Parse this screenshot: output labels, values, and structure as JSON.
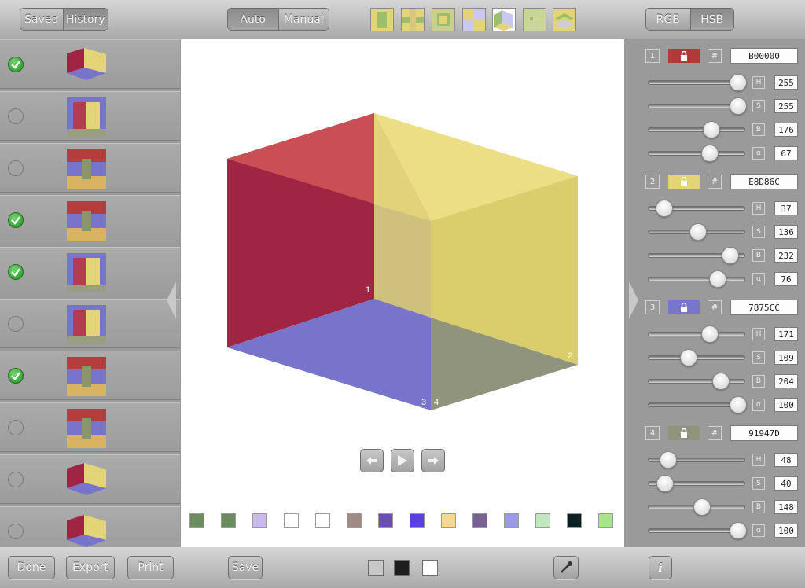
{
  "left_panel": {
    "tabs": [
      {
        "label": "Saved"
      },
      {
        "label": "History"
      }
    ],
    "items": [
      {
        "checked": true,
        "thumb": "cube-thumb"
      },
      {
        "checked": false,
        "thumb": "squares-thumb"
      },
      {
        "checked": false,
        "thumb": "stripes-thumb"
      },
      {
        "checked": true,
        "thumb": "stripes-thumb"
      },
      {
        "checked": true,
        "thumb": "squares-thumb"
      },
      {
        "checked": false,
        "thumb": "squares-thumb"
      },
      {
        "checked": true,
        "thumb": "stripes-thumb"
      },
      {
        "checked": false,
        "thumb": "stripes-thumb"
      },
      {
        "checked": false,
        "thumb": "cube-thumb"
      },
      {
        "checked": false,
        "thumb": "cube-thumb"
      }
    ],
    "buttons": {
      "done": "Done",
      "export": "Export",
      "print": "Print"
    }
  },
  "center": {
    "mode_tabs": [
      {
        "label": "Auto"
      },
      {
        "label": "Manual"
      }
    ],
    "layout_tools": [
      "stripes-layout-icon",
      "cross-layout-icon",
      "frame-layout-icon",
      "grid-layout-icon",
      "cube-layout-icon",
      "dots-layout-icon",
      "layers-layout-icon"
    ],
    "cube_labels": {
      "c1": "1",
      "c2": "2",
      "c3": "3",
      "c4": "4"
    },
    "swatches": [
      "#6f8c5e",
      "#6a8a60",
      "#c9b8ee",
      "#ffffff",
      "#ffffff",
      "#a08a84",
      "#6a4fae",
      "#5a3fe0",
      "#f7d796",
      "#786294",
      "#9a9ae8",
      "#c2e6c0",
      "#0b2124",
      "#a6e68a"
    ],
    "bottom": {
      "save": "Save"
    }
  },
  "right_panel": {
    "tabs": [
      {
        "label": "RGB"
      },
      {
        "label": "HSB"
      }
    ],
    "colors": [
      {
        "index": "1",
        "hex": "B00000",
        "swatch": "#b03a3a",
        "h": 255,
        "s": 255,
        "b": 176,
        "a": 67,
        "h_label": "255",
        "s_label": "255",
        "b_label": "176",
        "a_label": "67"
      },
      {
        "index": "2",
        "hex": "E8D86C",
        "swatch": "#e3d478",
        "h": 37,
        "s": 136,
        "b": 232,
        "a": 76,
        "h_label": "37",
        "s_label": "136",
        "b_label": "232",
        "a_label": "76"
      },
      {
        "index": "3",
        "hex": "7875CC",
        "swatch": "#7875cc",
        "h": 171,
        "s": 109,
        "b": 204,
        "a": 100,
        "h_label": "171",
        "s_label": "109",
        "b_label": "204",
        "a_label": "100"
      },
      {
        "index": "4",
        "hex": "91947D",
        "swatch": "#91947d",
        "h": 48,
        "s": 40,
        "b": 148,
        "a": 100,
        "h_label": "48",
        "s_label": "40",
        "b_label": "148",
        "a_label": "100"
      }
    ],
    "channel_labels": {
      "h": "H",
      "s": "S",
      "b": "B",
      "a": "α"
    },
    "hash_label": "#"
  },
  "colors": {
    "cube_red": "#a02545",
    "cube_yellow": "#e8dd7e",
    "cube_blue": "#7874cc",
    "cube_olive": "#91947d"
  }
}
